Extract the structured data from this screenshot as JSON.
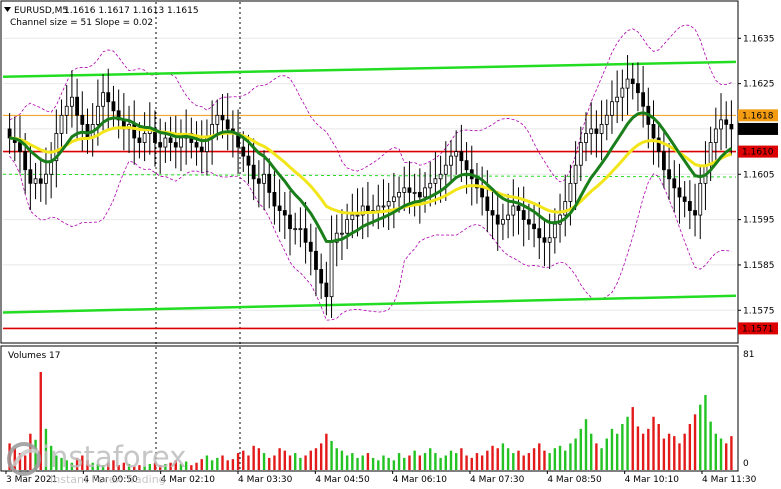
{
  "header": {
    "symbol": "EURUSD,M5",
    "ohlc": "1.1616 1.1617 1.1613 1.1615",
    "indicator": "Channel size = 51 Slope = 0.02"
  },
  "volume_panel": {
    "title": "Volumes 17",
    "max_label": "81",
    "min_label": "0"
  },
  "watermark": {
    "brand": "instaforex",
    "tagline": "Instant Forex Trading"
  },
  "colors": {
    "up": "#000000",
    "down": "#000000",
    "ma_fast": "#1a7f1a",
    "ma_slow": "#f2e51a",
    "channel": "#22dd22",
    "red_level": "#dd0000",
    "envelope": "#b000b0",
    "volume_bar": "#22c322",
    "volume_bar_down": "#e31a1a"
  },
  "chart_data": {
    "type": "candlestick",
    "title": "EURUSD,M5",
    "ylim": [
      1.1568,
      1.1643
    ],
    "y_ticks": [
      "1.1635",
      "1.1625",
      "1.1615",
      "1.1605",
      "1.1595",
      "1.1585",
      "1.1575"
    ],
    "x_ticks": [
      "3 Mar 2021",
      "4 Mar 00:50",
      "4 Mar 02:10",
      "4 Mar 03:30",
      "4 Mar 04:50",
      "4 Mar 06:10",
      "4 Mar 07:30",
      "4 Mar 08:50",
      "4 Mar 10:10",
      "4 Mar 11:30"
    ],
    "price_labels": [
      {
        "text": "1.1618",
        "value": 1.1618,
        "color": "#f39c12"
      },
      {
        "text": "1.1615",
        "value": 1.1615,
        "color": "#000000"
      },
      {
        "text": "1.1610",
        "value": 1.161,
        "color": "#dd0000"
      },
      {
        "text": "1.1571",
        "value": 1.1571,
        "color": "#dd0000"
      }
    ],
    "horizontal_levels": [
      {
        "value": 1.161,
        "color": "#dd0000"
      },
      {
        "value": 1.1571,
        "color": "#dd0000"
      },
      {
        "value": 1.1618,
        "color": "#f39c12"
      }
    ],
    "channel_lines": [
      {
        "from": [
          0,
          1.16265
        ],
        "to": [
          1,
          1.16298
        ]
      },
      {
        "from": [
          0,
          1.15745
        ],
        "to": [
          1,
          1.15782
        ]
      },
      {
        "from": [
          0,
          1.1605
        ],
        "to": [
          1,
          1.16044
        ]
      }
    ],
    "close": [
      1.1613,
      1.1612,
      1.161,
      1.1606,
      1.1603,
      1.1604,
      1.1603,
      1.1605,
      1.1608,
      1.1614,
      1.1618,
      1.162,
      1.1622,
      1.1618,
      1.1616,
      1.1613,
      1.1616,
      1.162,
      1.1623,
      1.1621,
      1.1619,
      1.1617,
      1.1615,
      1.1616,
      1.1613,
      1.1612,
      1.1614,
      1.1615,
      1.1612,
      1.1611,
      1.1613,
      1.1612,
      1.1611,
      1.1613,
      1.1614,
      1.1612,
      1.1611,
      1.161,
      1.1613,
      1.1616,
      1.1618,
      1.1617,
      1.1615,
      1.1614,
      1.1611,
      1.1609,
      1.1607,
      1.1604,
      1.1603,
      1.1605,
      1.1601,
      1.1598,
      1.1597,
      1.1596,
      1.1593,
      1.1593,
      1.1593,
      1.159,
      1.1588,
      1.1584,
      1.1581,
      1.1578,
      1.159,
      1.1592,
      1.1592,
      1.1595,
      1.1596,
      1.1596,
      1.1598,
      1.1597,
      1.1597,
      1.1598,
      1.1598,
      1.1599,
      1.16,
      1.1601,
      1.1602,
      1.1601,
      1.1601,
      1.16,
      1.1602,
      1.1603,
      1.1604,
      1.1605,
      1.1607,
      1.1609,
      1.161,
      1.1608,
      1.1606,
      1.1604,
      1.1602,
      1.16,
      1.1597,
      1.1596,
      1.1594,
      1.1595,
      1.1596,
      1.1598,
      1.1597,
      1.1595,
      1.1594,
      1.1593,
      1.1591,
      1.159,
      1.1591,
      1.1594,
      1.1596,
      1.1599,
      1.1603,
      1.1607,
      1.1612,
      1.1614,
      1.1615,
      1.1614,
      1.1616,
      1.1618,
      1.1621,
      1.1622,
      1.1624,
      1.1626,
      1.1625,
      1.1623,
      1.162,
      1.1616,
      1.1613,
      1.161,
      1.1606,
      1.1604,
      1.1602,
      1.16,
      1.1599,
      1.1597,
      1.1596,
      1.1603,
      1.1607,
      1.1612,
      1.1615,
      1.1617,
      1.1616,
      1.1615
    ],
    "volumes": [
      22,
      18,
      14,
      12,
      30,
      25,
      81,
      34,
      20,
      12,
      10,
      8,
      6,
      10,
      12,
      8,
      6,
      5,
      4,
      6,
      8,
      4,
      6,
      5,
      3,
      4,
      3,
      5,
      6,
      4,
      5,
      6,
      8,
      5,
      7,
      4,
      6,
      9,
      12,
      8,
      10,
      12,
      8,
      9,
      14,
      16,
      12,
      20,
      18,
      14,
      10,
      12,
      18,
      16,
      12,
      14,
      10,
      12,
      16,
      18,
      22,
      30,
      24,
      18,
      16,
      12,
      14,
      10,
      12,
      14,
      10,
      8,
      12,
      10,
      8,
      14,
      10,
      12,
      16,
      12,
      14,
      18,
      14,
      10,
      12,
      16,
      14,
      18,
      12,
      10,
      14,
      12,
      16,
      20,
      18,
      22,
      18,
      14,
      16,
      12,
      14,
      18,
      22,
      16,
      14,
      18,
      20,
      16,
      22,
      26,
      34,
      42,
      30,
      22,
      18,
      26,
      34,
      30,
      38,
      44,
      52,
      36,
      30,
      34,
      44,
      38,
      26,
      30,
      28,
      22,
      30,
      38,
      46,
      54,
      62,
      40,
      30,
      26,
      22,
      28
    ]
  }
}
